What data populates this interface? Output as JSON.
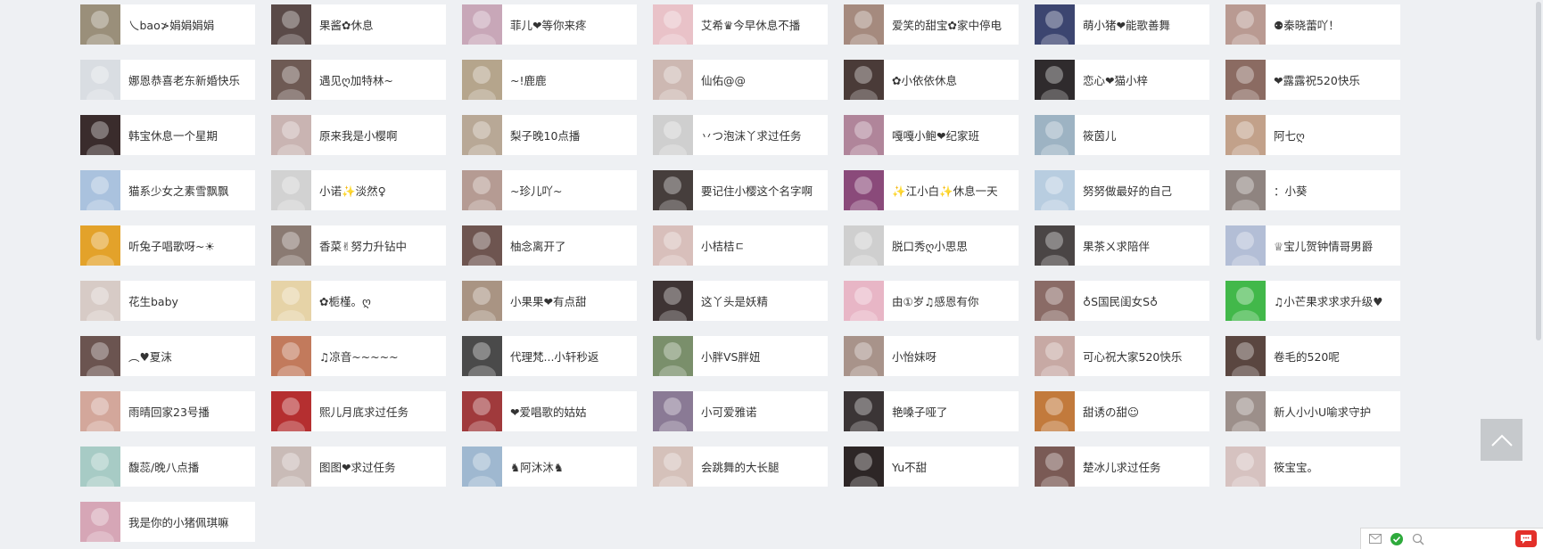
{
  "streamers": [
    {
      "name": "乀bao≯娟娟娟娟",
      "color": "#9a8f7a"
    },
    {
      "name": "果酱✿休息",
      "color": "#5a4a48"
    },
    {
      "name": "菲儿❤等你来疼",
      "color": "#c8a7b8"
    },
    {
      "name": "艾希♛今早休息不播",
      "color": "#e9c2c8"
    },
    {
      "name": "爱笑的甜宝✿家中停电",
      "color": "#a58a7e"
    },
    {
      "name": "萌小猪❤能歌善舞",
      "color": "#3c4570"
    },
    {
      "name": "⚉秦晓蕾吖！",
      "color": "#b99a92"
    },
    {
      "name": "娜恩恭喜老东新婚快乐",
      "color": "#d9dde2"
    },
    {
      "name": "遇见ღ加特林~",
      "color": "#6e5a54"
    },
    {
      "name": "~!鹿鹿",
      "color": "#b5a58c"
    },
    {
      "name": "仙佑@@",
      "color": "#cdb8b2"
    },
    {
      "name": "✿小依依休息",
      "color": "#4a3b38"
    },
    {
      "name": "恋心❤猫小梓",
      "color": "#2f2b2d"
    },
    {
      "name": "❤露露祝520快乐",
      "color": "#8b6b62"
    },
    {
      "name": "韩宝休息一个星期",
      "color": "#3a2c2c"
    },
    {
      "name": "原来我是小樱啊",
      "color": "#c9b4b2"
    },
    {
      "name": "梨子晚10点播",
      "color": "#b8a896"
    },
    {
      "name": "丷つ泡沫丫求过任务",
      "color": "#cfcfcf"
    },
    {
      "name": "嘎嘎小鲍❤纪家班",
      "color": "#b0859a"
    },
    {
      "name": "筱茵儿",
      "color": "#9db3c3"
    },
    {
      "name": "阿七ღ",
      "color": "#c2a18a"
    },
    {
      "name": "猫系少女之素雪飘飘",
      "color": "#aac2de"
    },
    {
      "name": "小诺✨淡然♀",
      "color": "#d2d2d2"
    },
    {
      "name": "~珍儿吖~",
      "color": "#b59b93"
    },
    {
      "name": "要记住小樱这个名字啊",
      "color": "#463e3c"
    },
    {
      "name": "✨江小白✨休息一天",
      "color": "#8a4a7a"
    },
    {
      "name": "努努做最好的自己",
      "color": "#b8cde0"
    },
    {
      "name": "：小葵",
      "color": "#8f8480"
    },
    {
      "name": "听兔子唱歌呀~☀",
      "color": "#e3a22a"
    },
    {
      "name": "香菜✌努力升钻中",
      "color": "#8a7a72"
    },
    {
      "name": "柚念离开了",
      "color": "#6e5550"
    },
    {
      "name": "小桔桔ㄷ",
      "color": "#d8bfbb"
    },
    {
      "name": "脱口秀ღ小思思",
      "color": "#cfcfcf"
    },
    {
      "name": "果茶ㄨ求陪伴",
      "color": "#4a4545"
    },
    {
      "name": "♕宝儿贺钟情哥男爵",
      "color": "#b3bed6"
    },
    {
      "name": "花生baby",
      "color": "#d7cbc6"
    },
    {
      "name": "✿栀槿。ღ",
      "color": "#e6d3a7"
    },
    {
      "name": "小果果❤有点甜",
      "color": "#a99483"
    },
    {
      "name": "这丫头是妖精",
      "color": "#3e3434"
    },
    {
      "name": "由①岁♫感恩有你",
      "color": "#e8b6c6"
    },
    {
      "name": "♁S国民闺女S♁",
      "color": "#8a6b66"
    },
    {
      "name": "♫小芒果求求求升级♥",
      "color": "#42b84a"
    },
    {
      "name": "︵♥夏沫",
      "color": "#6b5450"
    },
    {
      "name": "♫凉音~~~~~",
      "color": "#c27a5c"
    },
    {
      "name": "代理梵...小轩秒返",
      "color": "#4a4a4a"
    },
    {
      "name": "小胖VS胖妞",
      "color": "#7a8f6b"
    },
    {
      "name": "小怡妹呀",
      "color": "#a8938a"
    },
    {
      "name": "可心祝大家520快乐",
      "color": "#c7a9a4"
    },
    {
      "name": "卷毛的520呢",
      "color": "#5a4640"
    },
    {
      "name": "雨晴回家23号播",
      "color": "#d3a79b"
    },
    {
      "name": "熙儿月底求过任务",
      "color": "#b52f30"
    },
    {
      "name": "❤爱唱歌的姑姑",
      "color": "#a03a3c"
    },
    {
      "name": "小可爱雅诺",
      "color": "#8a7a95"
    },
    {
      "name": "艳嗓子哑了",
      "color": "#3b3536"
    },
    {
      "name": "甜诱の甜☺",
      "color": "#c27a3c"
    },
    {
      "name": "新人小小U喻求守护",
      "color": "#9c8f8a"
    },
    {
      "name": "馥蕊/晚八点播",
      "color": "#a7cbc5"
    },
    {
      "name": "图图❤求过任务",
      "color": "#c9bbb7"
    },
    {
      "name": "♞阿沐沐♞",
      "color": "#9fb8d0"
    },
    {
      "name": "会跳舞的大长腿",
      "color": "#d5c1ba"
    },
    {
      "name": "Yu不甜",
      "color": "#2d2626"
    },
    {
      "name": "楚冰儿求过任务",
      "color": "#7a5a55"
    },
    {
      "name": "筱宝宝。",
      "color": "#d6c2c0"
    },
    {
      "name": "我是你的小猪佩琪嘛",
      "color": "#d6a6b6"
    }
  ],
  "icons": {
    "back_to_top": "chevron-up-icon",
    "mail": "mail-icon",
    "check": "check-circle-icon",
    "zoom": "zoom-icon",
    "chat": "chat-bubble-icon"
  }
}
